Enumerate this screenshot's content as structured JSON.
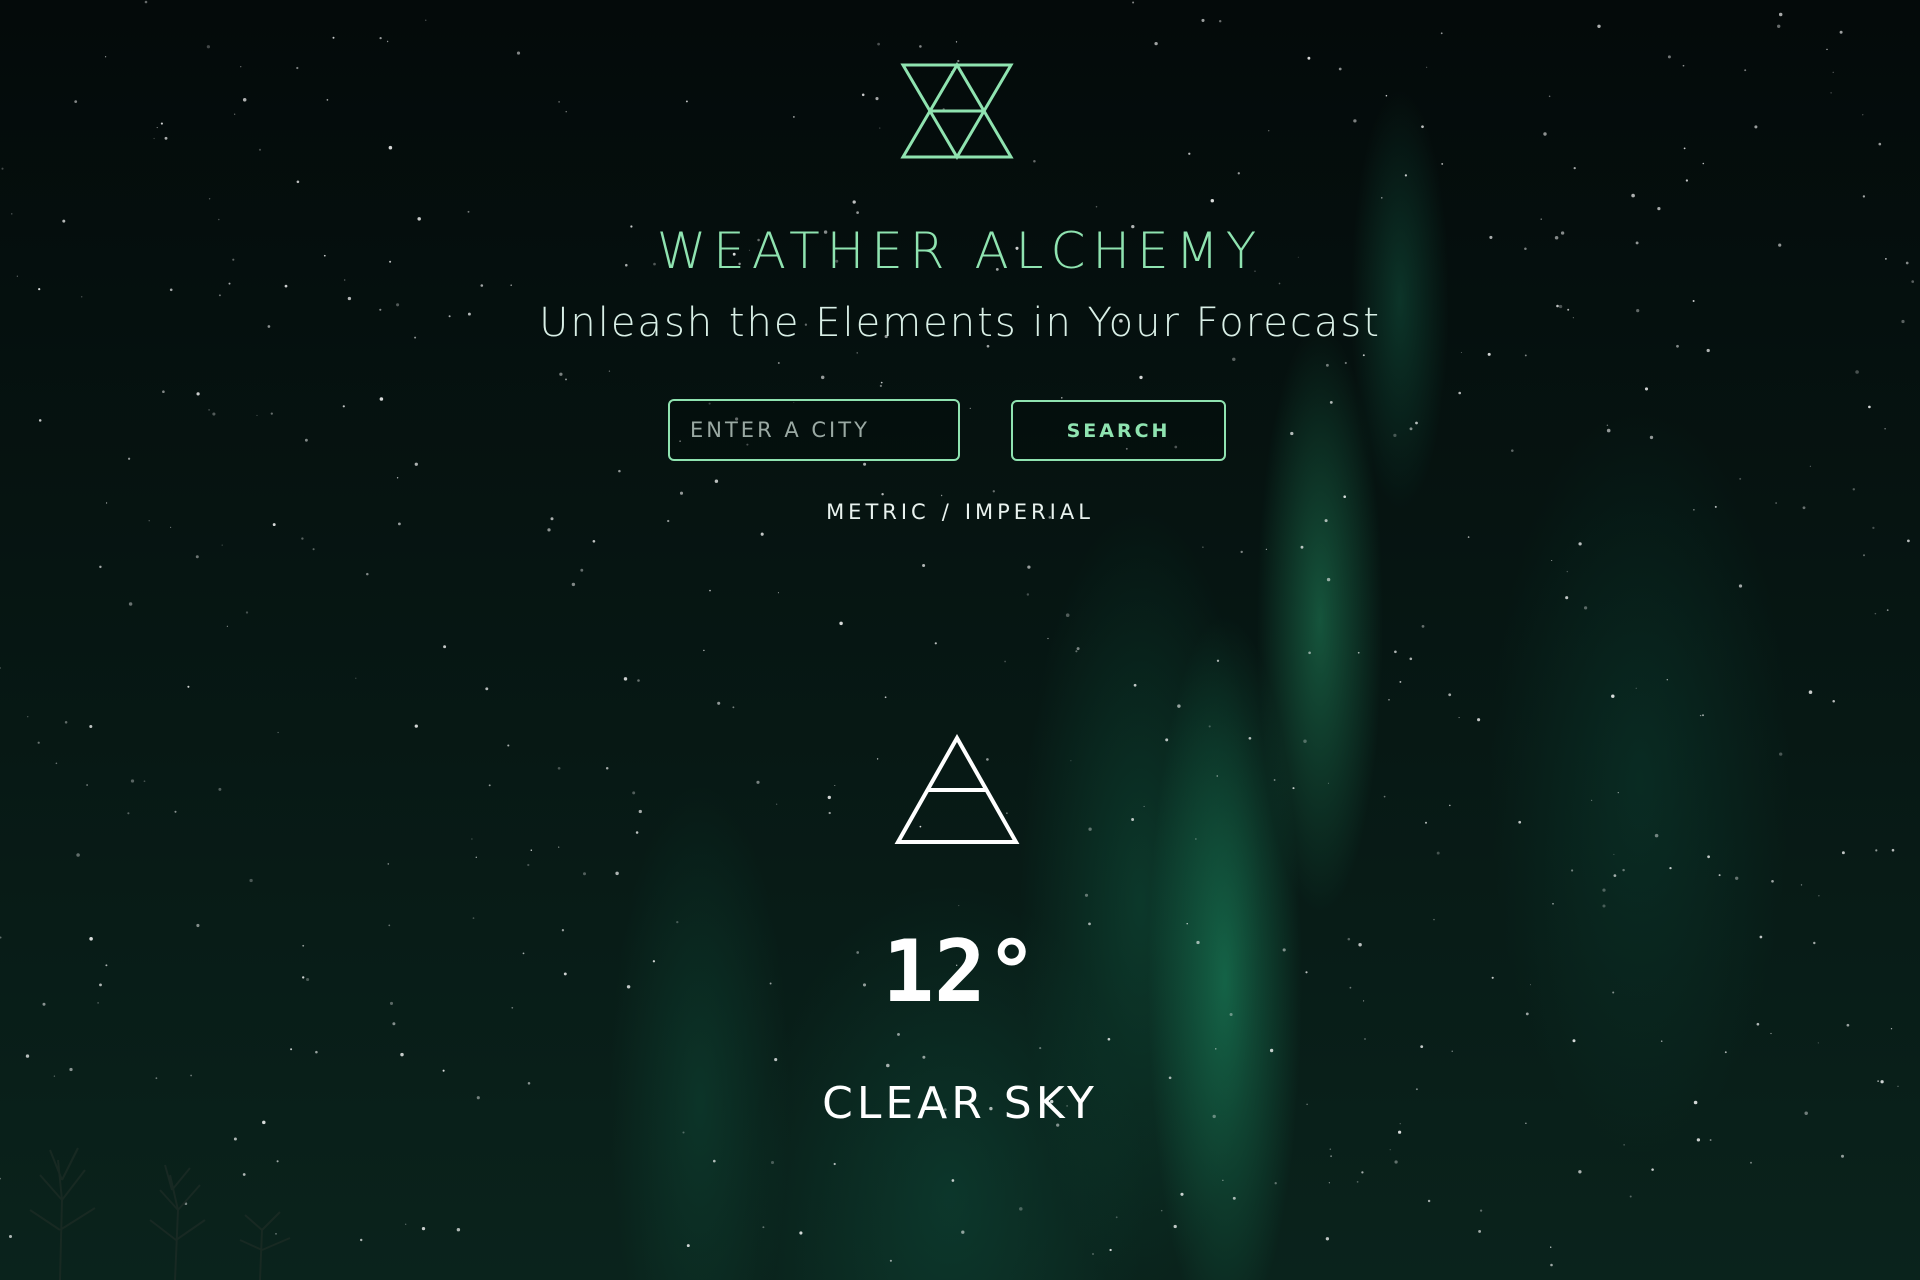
{
  "header": {
    "title": "WEATHER ALCHEMY",
    "subtitle": "Unleash the Elements in Your Forecast",
    "logo_icon": "alchemy-hexagram-icon"
  },
  "search": {
    "placeholder": "ENTER A CITY",
    "value": "",
    "button_label": "SEARCH"
  },
  "units": {
    "metric_label": "METRIC",
    "separator": "/",
    "imperial_label": "IMPERIAL"
  },
  "current": {
    "icon": "air-element-icon",
    "temperature": "12°",
    "condition": "CLEAR SKY"
  },
  "colors": {
    "accent": "#8fe3b0",
    "text": "#ffffff",
    "background": "#050d0b",
    "aurora": "#1e9669"
  }
}
